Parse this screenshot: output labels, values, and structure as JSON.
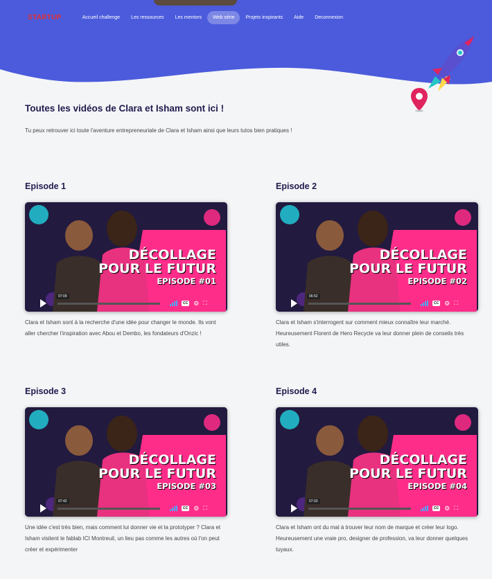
{
  "nav": {
    "logo": "STARTUP",
    "items": [
      {
        "label": "Accueil challenge",
        "active": false
      },
      {
        "label": "Les ressources",
        "active": false
      },
      {
        "label": "Les mentors",
        "active": false
      },
      {
        "label": "Web série",
        "active": true
      },
      {
        "label": "Projets inspirants",
        "active": false
      },
      {
        "label": "Aide",
        "active": false
      },
      {
        "label": "Deconnexion",
        "active": false
      }
    ]
  },
  "colors": {
    "header_blue": "#4b5bdc",
    "title_navy": "#1f1b4d",
    "logo_red": "#e8302f",
    "pin_red": "#e0245e"
  },
  "page": {
    "title": "Toutes les vidéos de Clara et Isham sont ici !",
    "intro": "Tu peux retrouver ici toute l'aventure entrepreneuriale de Clara et Isham ainsi que leurs tutos bien pratiques !"
  },
  "episodes": [
    {
      "title": "Episode 1",
      "line1": "DÉCOLLAGE",
      "line2": "POUR LE FUTUR",
      "line3": "EPISODE #01",
      "time": "07:09",
      "description": "Clara et Isham sont à la recherche d'une idée pour changer le monde. Ils vont aller chercher l'inspiration avec Abou et Dembo, les fondateurs d'Onzic !"
    },
    {
      "title": "Episode 2",
      "line1": "DÉCOLLAGE",
      "line2": "POUR LE FUTUR",
      "line3": "EPISODE #02",
      "time": "06:52",
      "description": "Clara et Isham s'interrogent sur comment mieux connaître leur marché. Heureusement Florent de Hero Recycle va leur donner plein de conseils très utiles."
    },
    {
      "title": "Episode 3",
      "line1": "DÉCOLLAGE",
      "line2": "POUR LE FUTUR",
      "line3": "EPISODE #03",
      "time": "07:42",
      "description": "Une idée c'est très bien, mais comment lui donner vie et la prototyper ? Clara et Isham visitent le fablab ICI Montreuil, un lieu pas comme les autres où l'on peut créer et expérimenter"
    },
    {
      "title": "Episode 4",
      "line1": "DÉCOLLAGE",
      "line2": "POUR LE FUTUR",
      "line3": "EPISODE #04",
      "time": "07:03",
      "description": "Clara et Isham ont du mal à trouver leur nom de marque et créer leur logo. Heureusement une vraie pro, designer de profession, va leur donner quelques tuyaux."
    }
  ],
  "video_controls": {
    "cc_label": "CC",
    "play_icon": "play-icon",
    "settings_icon": "gear-icon",
    "fullscreen_icon": "fullscreen-icon",
    "volume_icon": "volume-icon"
  }
}
